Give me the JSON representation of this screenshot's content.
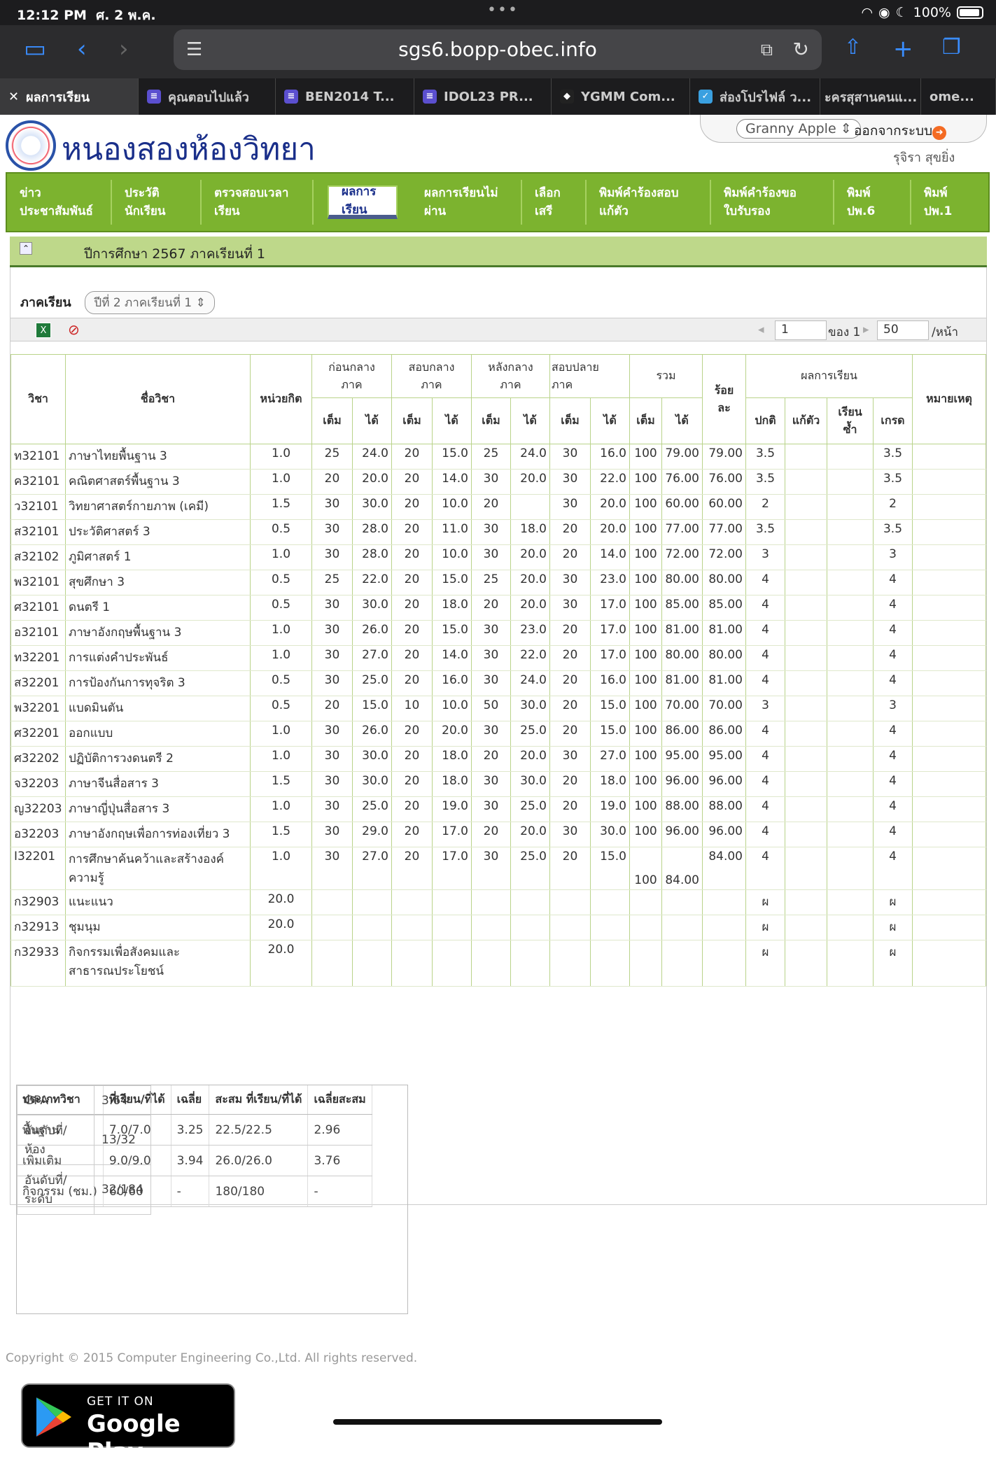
{
  "status": {
    "time": "12:12 PM",
    "date": "ศ. 2 พ.ค.",
    "battery": "100%"
  },
  "browser": {
    "url": "sgs6.bopp-obec.info"
  },
  "tabs": [
    {
      "label": "ผลการเรียน"
    },
    {
      "label": "คุณตอบไปแล้ว"
    },
    {
      "label": "BEN2014 T..."
    },
    {
      "label": "IDOL23 PR..."
    },
    {
      "label": "YGMM Com..."
    },
    {
      "label": "ส่องโปรไฟล์ ว..."
    },
    {
      "label": "ะครสุสานคนแ..."
    },
    {
      "label": "ome..."
    }
  ],
  "site": {
    "title": "หนองสองห้องวิทยา",
    "user_select": "Granny Apple",
    "logout": "ออกจากระบบ",
    "username": "รุจิรา สุขยิ่ง"
  },
  "menu": [
    {
      "label": "ข่าว\nประชาสัมพันธ์"
    },
    {
      "label": "ประวัติ\nนักเรียน"
    },
    {
      "label": "ตรวจสอบเวลา\nเรียน"
    },
    {
      "label": "ผลการ\nเรียน"
    },
    {
      "label": "ผลการเรียนไม่\nผ่าน"
    },
    {
      "label": "เลือก\nเสรี"
    },
    {
      "label": "พิมพ์คำร้องสอบ\nแก้ตัว"
    },
    {
      "label": "พิมพ์คำร้องขอ\nใบรับรอง"
    },
    {
      "label": "พิมพ์\nปพ.6"
    },
    {
      "label": "พิมพ์\nปพ.1"
    }
  ],
  "year_title": "ปีการศึกษา 2567 ภาคเรียนที่ 1",
  "term": {
    "label": "ภาคเรียน",
    "value": "ปีที่ 2 ภาคเรียนที่ 1"
  },
  "pager": {
    "page": "1",
    "of": "ของ 1",
    "per": "50",
    "per_label": "/หน้า"
  },
  "table_headers": {
    "code": "วิชา",
    "name": "ชื่อวิชา",
    "credit": "หน่วยกิต",
    "mid_before": "ก่อนกลาง\nภาค",
    "mid_exam": "สอบกลาง\nภาค",
    "after_mid": "หลังกลาง\nภาค",
    "final": "สอบปลาย\nภาค",
    "total": "รวม",
    "percent": "ร้อย\nละ",
    "result": "ผลการเรียน",
    "remark": "หมายเหตุ",
    "full": "เต็ม",
    "got": "ได้",
    "normal": "ปกติ",
    "retake": "แก้ตัว",
    "repeat": "เรียน\nซ้ำ",
    "grade": "เกรด"
  },
  "rows": [
    [
      "ท32101",
      "ภาษาไทยพื้นฐาน 3",
      "1.0",
      "25",
      "24.0",
      "20",
      "15.0",
      "25",
      "24.0",
      "30",
      "16.0",
      "100",
      "79.00",
      "79.00",
      "3.5",
      "",
      "",
      "3.5",
      ""
    ],
    [
      "ค32101",
      "คณิตศาสตร์พื้นฐาน 3",
      "1.0",
      "20",
      "20.0",
      "20",
      "14.0",
      "30",
      "20.0",
      "30",
      "22.0",
      "100",
      "76.00",
      "76.00",
      "3.5",
      "",
      "",
      "3.5",
      ""
    ],
    [
      "ว32101",
      "วิทยาศาสตร์กายภาพ (เคมี)",
      "1.5",
      "30",
      "30.0",
      "20",
      "10.0",
      "20",
      "",
      "30",
      "20.0",
      "100",
      "60.00",
      "60.00",
      "2",
      "",
      "",
      "2",
      ""
    ],
    [
      "ส32101",
      "ประวัติศาสตร์ 3",
      "0.5",
      "30",
      "28.0",
      "20",
      "11.0",
      "30",
      "18.0",
      "20",
      "20.0",
      "100",
      "77.00",
      "77.00",
      "3.5",
      "",
      "",
      "3.5",
      ""
    ],
    [
      "ส32102",
      "ภูมิศาสตร์ 1",
      "1.0",
      "30",
      "28.0",
      "20",
      "10.0",
      "30",
      "20.0",
      "20",
      "14.0",
      "100",
      "72.00",
      "72.00",
      "3",
      "",
      "",
      "3",
      ""
    ],
    [
      "พ32101",
      "สุขศึกษา 3",
      "0.5",
      "25",
      "22.0",
      "20",
      "15.0",
      "25",
      "20.0",
      "30",
      "23.0",
      "100",
      "80.00",
      "80.00",
      "4",
      "",
      "",
      "4",
      ""
    ],
    [
      "ศ32101",
      "ดนตรี 1",
      "0.5",
      "30",
      "30.0",
      "20",
      "18.0",
      "20",
      "20.0",
      "30",
      "17.0",
      "100",
      "85.00",
      "85.00",
      "4",
      "",
      "",
      "4",
      ""
    ],
    [
      "อ32101",
      "ภาษาอังกฤษพื้นฐาน 3",
      "1.0",
      "30",
      "26.0",
      "20",
      "15.0",
      "30",
      "23.0",
      "20",
      "17.0",
      "100",
      "81.00",
      "81.00",
      "4",
      "",
      "",
      "4",
      ""
    ],
    [
      "ท32201",
      "การแต่งคำประพันธ์",
      "1.0",
      "30",
      "27.0",
      "20",
      "14.0",
      "30",
      "22.0",
      "20",
      "17.0",
      "100",
      "80.00",
      "80.00",
      "4",
      "",
      "",
      "4",
      ""
    ],
    [
      "ส32201",
      "การป้องกันการทุจริต 3",
      "0.5",
      "30",
      "25.0",
      "20",
      "16.0",
      "30",
      "24.0",
      "20",
      "16.0",
      "100",
      "81.00",
      "81.00",
      "4",
      "",
      "",
      "4",
      ""
    ],
    [
      "พ32201",
      "แบดมินตัน",
      "0.5",
      "20",
      "15.0",
      "10",
      "10.0",
      "50",
      "30.0",
      "20",
      "15.0",
      "100",
      "70.00",
      "70.00",
      "3",
      "",
      "",
      "3",
      ""
    ],
    [
      "ศ32201",
      "ออกแบบ",
      "1.0",
      "30",
      "26.0",
      "20",
      "20.0",
      "30",
      "25.0",
      "20",
      "15.0",
      "100",
      "86.00",
      "86.00",
      "4",
      "",
      "",
      "4",
      ""
    ],
    [
      "ศ32202",
      "ปฏิบัติการวงดนตรี 2",
      "1.0",
      "30",
      "30.0",
      "20",
      "18.0",
      "20",
      "20.0",
      "30",
      "27.0",
      "100",
      "95.00",
      "95.00",
      "4",
      "",
      "",
      "4",
      ""
    ],
    [
      "จ32203",
      "ภาษาจีนสื่อสาร 3",
      "1.5",
      "30",
      "30.0",
      "20",
      "18.0",
      "30",
      "30.0",
      "20",
      "18.0",
      "100",
      "96.00",
      "96.00",
      "4",
      "",
      "",
      "4",
      ""
    ],
    [
      "ญ32203",
      "ภาษาญี่ปุ่นสื่อสาร 3",
      "1.0",
      "30",
      "25.0",
      "20",
      "19.0",
      "30",
      "25.0",
      "20",
      "19.0",
      "100",
      "88.00",
      "88.00",
      "4",
      "",
      "",
      "4",
      ""
    ],
    [
      "อ32203",
      "ภาษาอังกฤษเพื่อการท่องเที่ยว 3",
      "1.5",
      "30",
      "29.0",
      "20",
      "17.0",
      "20",
      "20.0",
      "30",
      "30.0",
      "100",
      "96.00",
      "96.00",
      "4",
      "",
      "",
      "4",
      ""
    ],
    [
      "I32201",
      "การศึกษาค้นคว้าและสร้างองค์ความรู้",
      "1.0",
      "30",
      "27.0",
      "20",
      "17.0",
      "30",
      "25.0",
      "20",
      "15.0",
      "100",
      "84.00",
      "84.00",
      "4",
      "",
      "",
      "4",
      ""
    ],
    [
      "ก32903",
      "แนะแนว",
      "20.0",
      "",
      "",
      "",
      "",
      "",
      "",
      "",
      "",
      "",
      "",
      "",
      "ผ",
      "",
      "",
      "ผ",
      ""
    ],
    [
      "ก32913",
      "ชุมนุม",
      "20.0",
      "",
      "",
      "",
      "",
      "",
      "",
      "",
      "",
      "",
      "",
      "",
      "ผ",
      "",
      "",
      "ผ",
      ""
    ],
    [
      "ก32933",
      "กิจกรรมเพื่อสังคมและสาธารณประโยชน์",
      "20.0",
      "",
      "",
      "",
      "",
      "",
      "",
      "",
      "",
      "",
      "",
      "",
      "ผ",
      "",
      "",
      "ผ",
      ""
    ]
  ],
  "summary": {
    "headers": [
      "ประเภทวิชา",
      "ที่เรียน/ที่ได้",
      "เฉลี่ย",
      "สะสม ที่เรียน/ที่ได้",
      "เฉลี่ยสะสม"
    ],
    "rows": [
      [
        "พื้นฐาน",
        "7.0/7.0",
        "3.25",
        "22.5/22.5",
        "2.96"
      ],
      [
        "เพิ่มเติม",
        "9.0/9.0",
        "3.94",
        "26.0/26.0",
        "3.76"
      ],
      [
        "กิจกรรม (ชม.)",
        "60/60",
        "-",
        "180/180",
        "-"
      ]
    ],
    "gpa": [
      [
        "GPA",
        "3.64"
      ],
      [
        "อันดับที่/ห้อง",
        "13/32"
      ],
      [
        "อันดับที่/ระดับ",
        "32/184"
      ]
    ]
  },
  "footer": "Copyright © 2015 Computer Engineering Co.,Ltd. All rights reserved.",
  "gplay": {
    "small": "GET IT ON",
    "big": "Google Play"
  }
}
